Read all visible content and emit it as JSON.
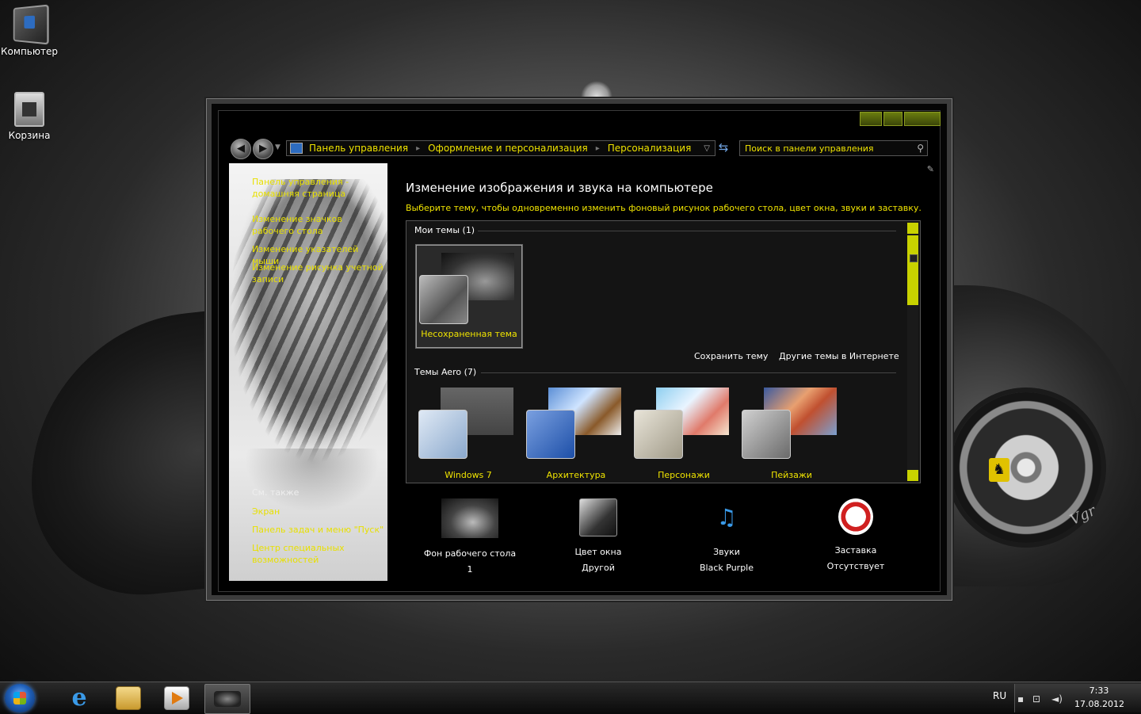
{
  "desktop": {
    "icons": [
      {
        "label": "Компьютер",
        "icon": "computer-icon"
      },
      {
        "label": "Корзина",
        "icon": "recycle-bin-icon"
      }
    ]
  },
  "window": {
    "nav": {
      "breadcrumbs": [
        "Панель управления",
        "Оформление и персонализация",
        "Персонализация"
      ],
      "search_placeholder": "Поиск в панели управления"
    },
    "left_pane": {
      "links": [
        "Панель управления - домашняя страница",
        "Изменение значков рабочего стола",
        "Изменение указателей мыши",
        "Изменение рисунка учетной записи"
      ],
      "see_also_heading": "См. также",
      "see_also_links": [
        "Экран",
        "Панель задач и меню \"Пуск\"",
        "Центр специальных возможностей"
      ]
    },
    "main": {
      "title": "Изменение изображения и звука на компьютере",
      "subtitle": "Выберите тему, чтобы одновременно изменить фоновый рисунок рабочего стола, цвет окна, звуки и заставку.",
      "my_themes_heading": "Мои темы (1)",
      "my_themes": [
        {
          "label": "Несохраненная тема",
          "selected": true
        }
      ],
      "save_theme_link": "Сохранить тему",
      "online_themes_link": "Другие темы в Интернете",
      "aero_heading": "Темы Aero (7)",
      "aero_themes": [
        {
          "label": "Windows 7"
        },
        {
          "label": "Архитектура"
        },
        {
          "label": "Персонажи"
        },
        {
          "label": "Пейзажи"
        }
      ],
      "bottom": [
        {
          "label": "Фон рабочего стола",
          "value": "1",
          "icon": "desktop-background-icon"
        },
        {
          "label": "Цвет окна",
          "value": "Другой",
          "icon": "window-color-icon"
        },
        {
          "label": "Звуки",
          "value": "Black Purple",
          "icon": "sounds-icon"
        },
        {
          "label": "Заставка",
          "value": "Отсутствует",
          "icon": "screensaver-icon"
        }
      ]
    }
  },
  "taskbar": {
    "language": "RU",
    "time": "7:33",
    "date": "17.08.2012"
  },
  "colors": {
    "accent_yellow": "#f0e400",
    "scrollbar": "#c8d200",
    "window_bg": "#050505"
  }
}
